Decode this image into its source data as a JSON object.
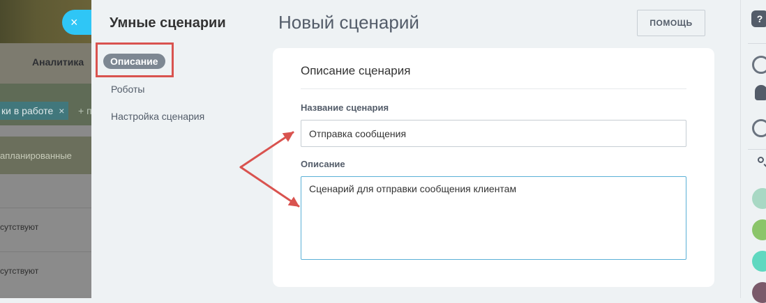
{
  "background": {
    "nav_label": "Аналитика",
    "chip_label": "ки в работе",
    "chip_close": "×",
    "add_more": "+ п",
    "planned_label": "апланированные",
    "rows": [
      "сутствуют",
      "сутствуют"
    ],
    "close_glyph": "×"
  },
  "sidebar": {
    "title": "Умные сценарии",
    "items": [
      {
        "label": "Описание",
        "active": true
      },
      {
        "label": "Роботы",
        "active": false
      },
      {
        "label": "Настройка сценария",
        "active": false
      }
    ]
  },
  "header": {
    "title": "Новый сценарий",
    "help_label": "ПОМОЩЬ"
  },
  "card": {
    "title": "Описание сценария",
    "name_label": "Название сценария",
    "name_value": "Отправка сообщения",
    "description_label": "Описание",
    "description_value": "Сценарий для отправки сообщения клиентам"
  },
  "right_strip": {
    "help_glyph": "?"
  },
  "colors": {
    "accent": "#2fc6f6",
    "annotation": "#d9534f",
    "active_pill": "#7d8792",
    "focus_border": "#5ab0d6"
  }
}
